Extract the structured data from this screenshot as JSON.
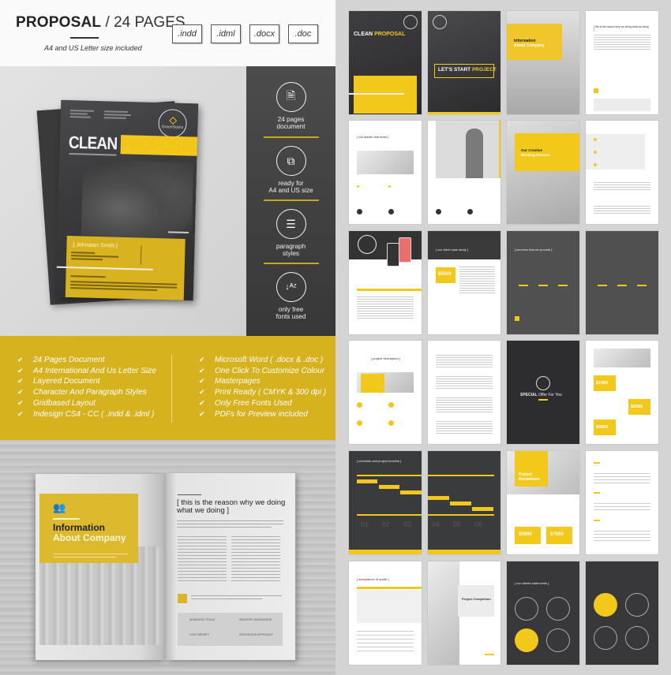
{
  "header": {
    "title_bold": "PROPOSAL",
    "title_light": "/ 24 PAGES",
    "subtitle": "A4 and US Letter size included",
    "formats": [
      ".indd",
      ".idml",
      ".docx",
      ".doc"
    ]
  },
  "cover": {
    "title_white": "CLEAN",
    "title_yellow": "PROPOSAL",
    "logo_name": "GreenSocks",
    "client_name": "[ Johnatan Smith ]"
  },
  "features": [
    {
      "icon": "document-icon",
      "glyph": "🗎",
      "label_line1": "24 pages",
      "label_line2": "document"
    },
    {
      "icon": "resize-icon",
      "glyph": "⧉",
      "label_line1": "ready for",
      "label_line2": "A4 and US size"
    },
    {
      "icon": "list-icon",
      "glyph": "☰",
      "label_line1": "paragraph",
      "label_line2": "styles"
    },
    {
      "icon": "sort-az-icon",
      "glyph": "↓ᴬᶻ",
      "label_line1": "only free",
      "label_line2": "fonts used"
    }
  ],
  "checklist": {
    "left": [
      "24 Pages Document",
      "A4 International And Us Letter Size",
      "Layered Document",
      "Character And Paragraph Styles",
      "Gridbased Layout",
      "Indesign CS4 - CC ( .indd & .idml )"
    ],
    "right": [
      "Microsoft Word ( .docx & .doc )",
      "One Click To Customize Colour",
      "Masterpages",
      "Print Ready ( CMYK & 300 dpi )",
      "Only Free Fonts Used",
      "PDFs for Preview included"
    ],
    "check_glyph": "✔"
  },
  "spread": {
    "left_heading_line1": "Information",
    "left_heading_line2": "About Company",
    "right_quote": "[ this is the reason why we doing what we doing ]",
    "box_items": [
      "ADVANCED TOOLS",
      "INDUSTRY KNOWLEDGE",
      "COST BENEFIT",
      "INTEGRATED APPROACH"
    ]
  },
  "pages": {
    "p1_title_white": "CLEAN",
    "p1_title_yellow": "PROPOSAL",
    "p2_title_white": "LET'S START",
    "p2_title_yellow": "PROJECT",
    "p3_heading_line1": "Information",
    "p3_heading_line2": "About Company",
    "p4_heading": "[ this is the reason why we doing what we doing ]",
    "p5_heading": "[ our leader and team ]",
    "p7_heading_line1": "Our Creative",
    "p7_heading_line2": "Working Process",
    "p10_heading": "[ our client case study ]",
    "p10_price": "$5500",
    "p11_heading": "[ services that we provide ]",
    "p13_heading": "[ project description ]",
    "p15_title_bold": "SPECIAL",
    "p15_title_light": "Offer For You",
    "p16_prices": [
      "$1990",
      "$2590",
      "$4850"
    ],
    "p17_heading": "[ schedule and project timeline ]",
    "timeline_numbers": [
      "01",
      "02",
      "03",
      "04",
      "05",
      "06"
    ],
    "p19_heading_line1": "Project",
    "p19_heading_line2": "Breakdown",
    "p19_prices": [
      "$5990",
      "$7550"
    ],
    "p21_heading": "[ acceptance of quote ]",
    "p22_heading": "Project Completion",
    "p23_heading": "[ our clients statements ]"
  },
  "colors": {
    "accent_yellow": "#f2c81b",
    "banner_yellow": "#d6b21f",
    "dark_gray": "#464646"
  }
}
